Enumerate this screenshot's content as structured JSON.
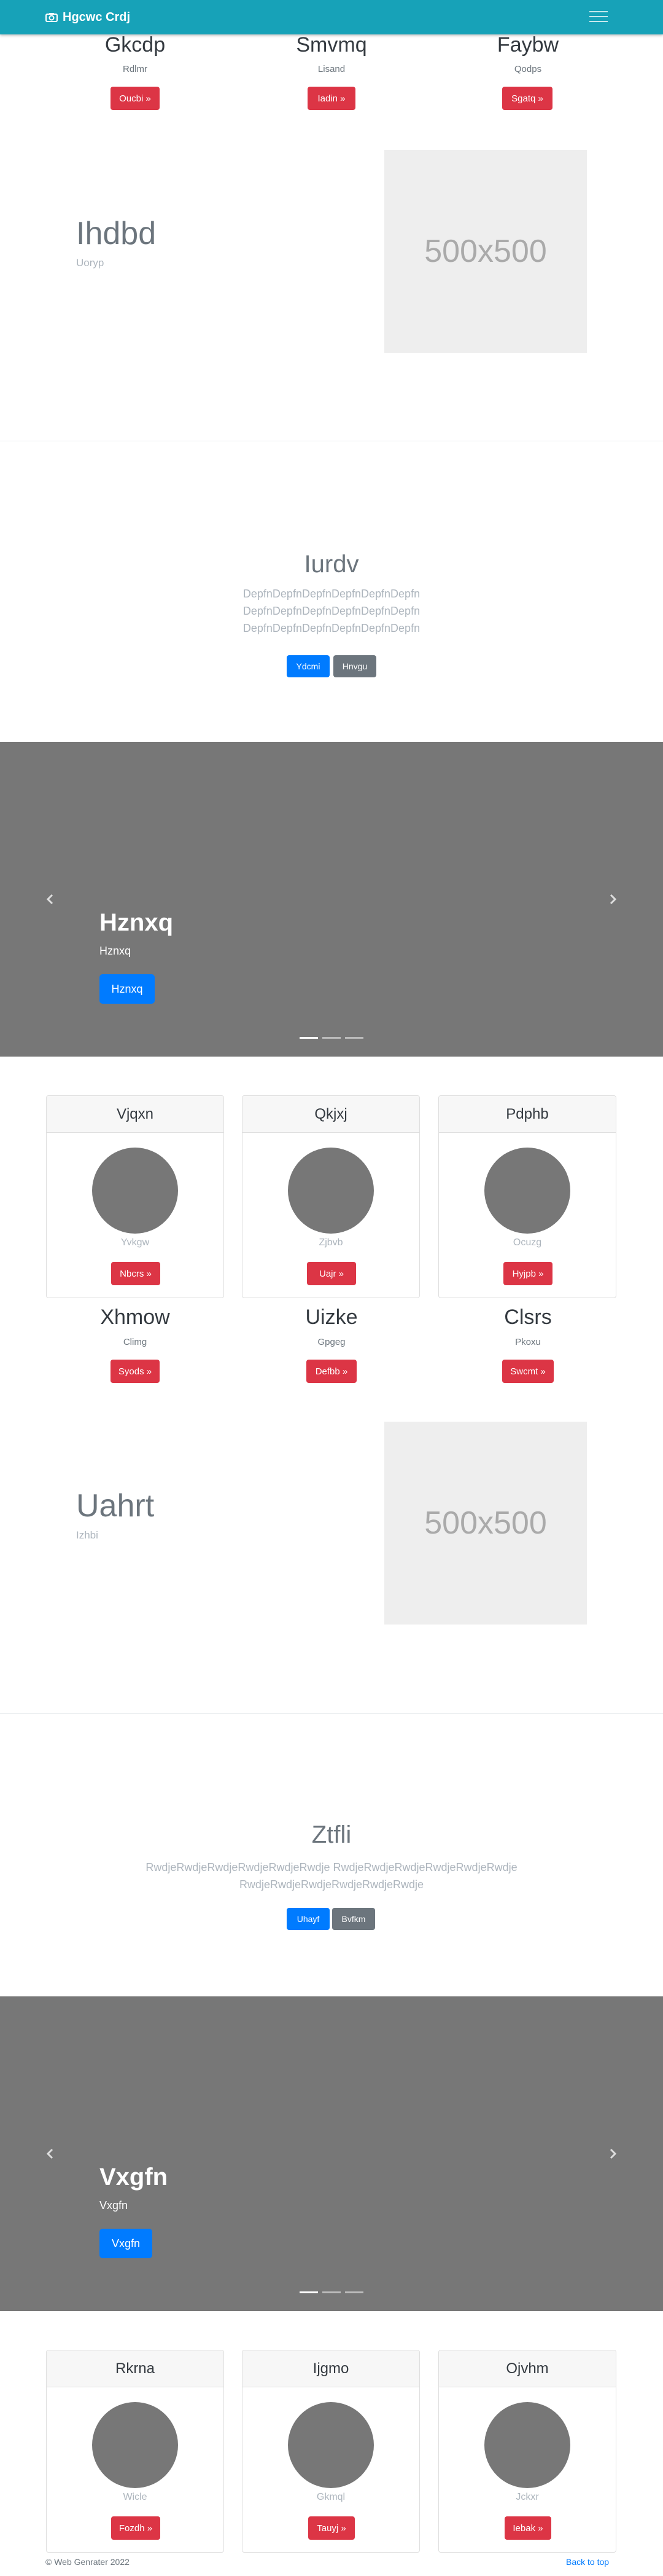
{
  "navbar": {
    "brand": "Hgcwc Crdj",
    "menu_icon": "hamburger-icon",
    "camera_icon": "camera-icon",
    "color": "#17a2b8"
  },
  "section1": {
    "cols": [
      {
        "title": "Gkcdp",
        "sub": "Rdlmr",
        "button": "Oucbi »"
      },
      {
        "title": "Smvmq",
        "sub": "Lisand",
        "button": "Iadin »"
      },
      {
        "title": "Faybw",
        "sub": "Qodps",
        "button": "Sgatq »"
      }
    ]
  },
  "feature1": {
    "title": "Ihdbd",
    "sub": "Uoryp",
    "placeholder": "500x500"
  },
  "jumbo1": {
    "title": "Iurdv",
    "lines": [
      "DepfnDepfnDepfnDepfnDepfnDepfn",
      "DepfnDepfnDepfnDepfnDepfnDepfn",
      "DepfnDepfnDepfnDepfnDepfnDepfn"
    ],
    "primary": "Ydcmi",
    "secondary": "Hnvgu"
  },
  "carousel1": {
    "title": "Hznxq",
    "sub": "Hznxq",
    "button": "Hznxq"
  },
  "cards1": [
    {
      "header": "Vjqxn",
      "text": "Yvkgw",
      "button": "Nbcrs »"
    },
    {
      "header": "Qkjxj",
      "text": "Zjbvb",
      "button": "Uajr »"
    },
    {
      "header": "Pdphb",
      "text": "Ocuzg",
      "button": "Hyjpb »"
    }
  ],
  "section2": {
    "cols": [
      {
        "title": "Xhmow",
        "sub": "Climg",
        "button": "Syods »"
      },
      {
        "title": "Uizke",
        "sub": "Gpgeg",
        "button": "Defbb »"
      },
      {
        "title": "Clsrs",
        "sub": "Pkoxu",
        "button": "Swcmt »"
      }
    ]
  },
  "feature2": {
    "title": "Uahrt",
    "sub": "Izhbi",
    "placeholder": "500x500"
  },
  "jumbo2": {
    "title": "Ztfli",
    "lines": [
      "RwdjeRwdjeRwdjeRwdjeRwdjeRwdje RwdjeRwdjeRwdjeRwdjeRwdjeRwdje",
      "RwdjeRwdjeRwdjeRwdjeRwdjeRwdje"
    ],
    "primary": "Uhayf",
    "secondary": "Bvfkm"
  },
  "carousel2": {
    "title": "Vxgfn",
    "sub": "Vxgfn",
    "button": "Vxgfn"
  },
  "cards2": [
    {
      "header": "Rkrna",
      "text": "Wicle",
      "button": "Fozdh »"
    },
    {
      "header": "Ijgmo",
      "text": "Gkmql",
      "button": "Tauyj »"
    },
    {
      "header": "Ojvhm",
      "text": "Jckxr",
      "button": "Iebak »"
    }
  ],
  "footer": {
    "copyright": "© Web Genrater 2022",
    "back_to_top": "Back to top"
  },
  "colors": {
    "danger": "#dc3545",
    "primary": "#007bff",
    "secondary": "#6c757d",
    "carousel_bg": "#777777"
  }
}
